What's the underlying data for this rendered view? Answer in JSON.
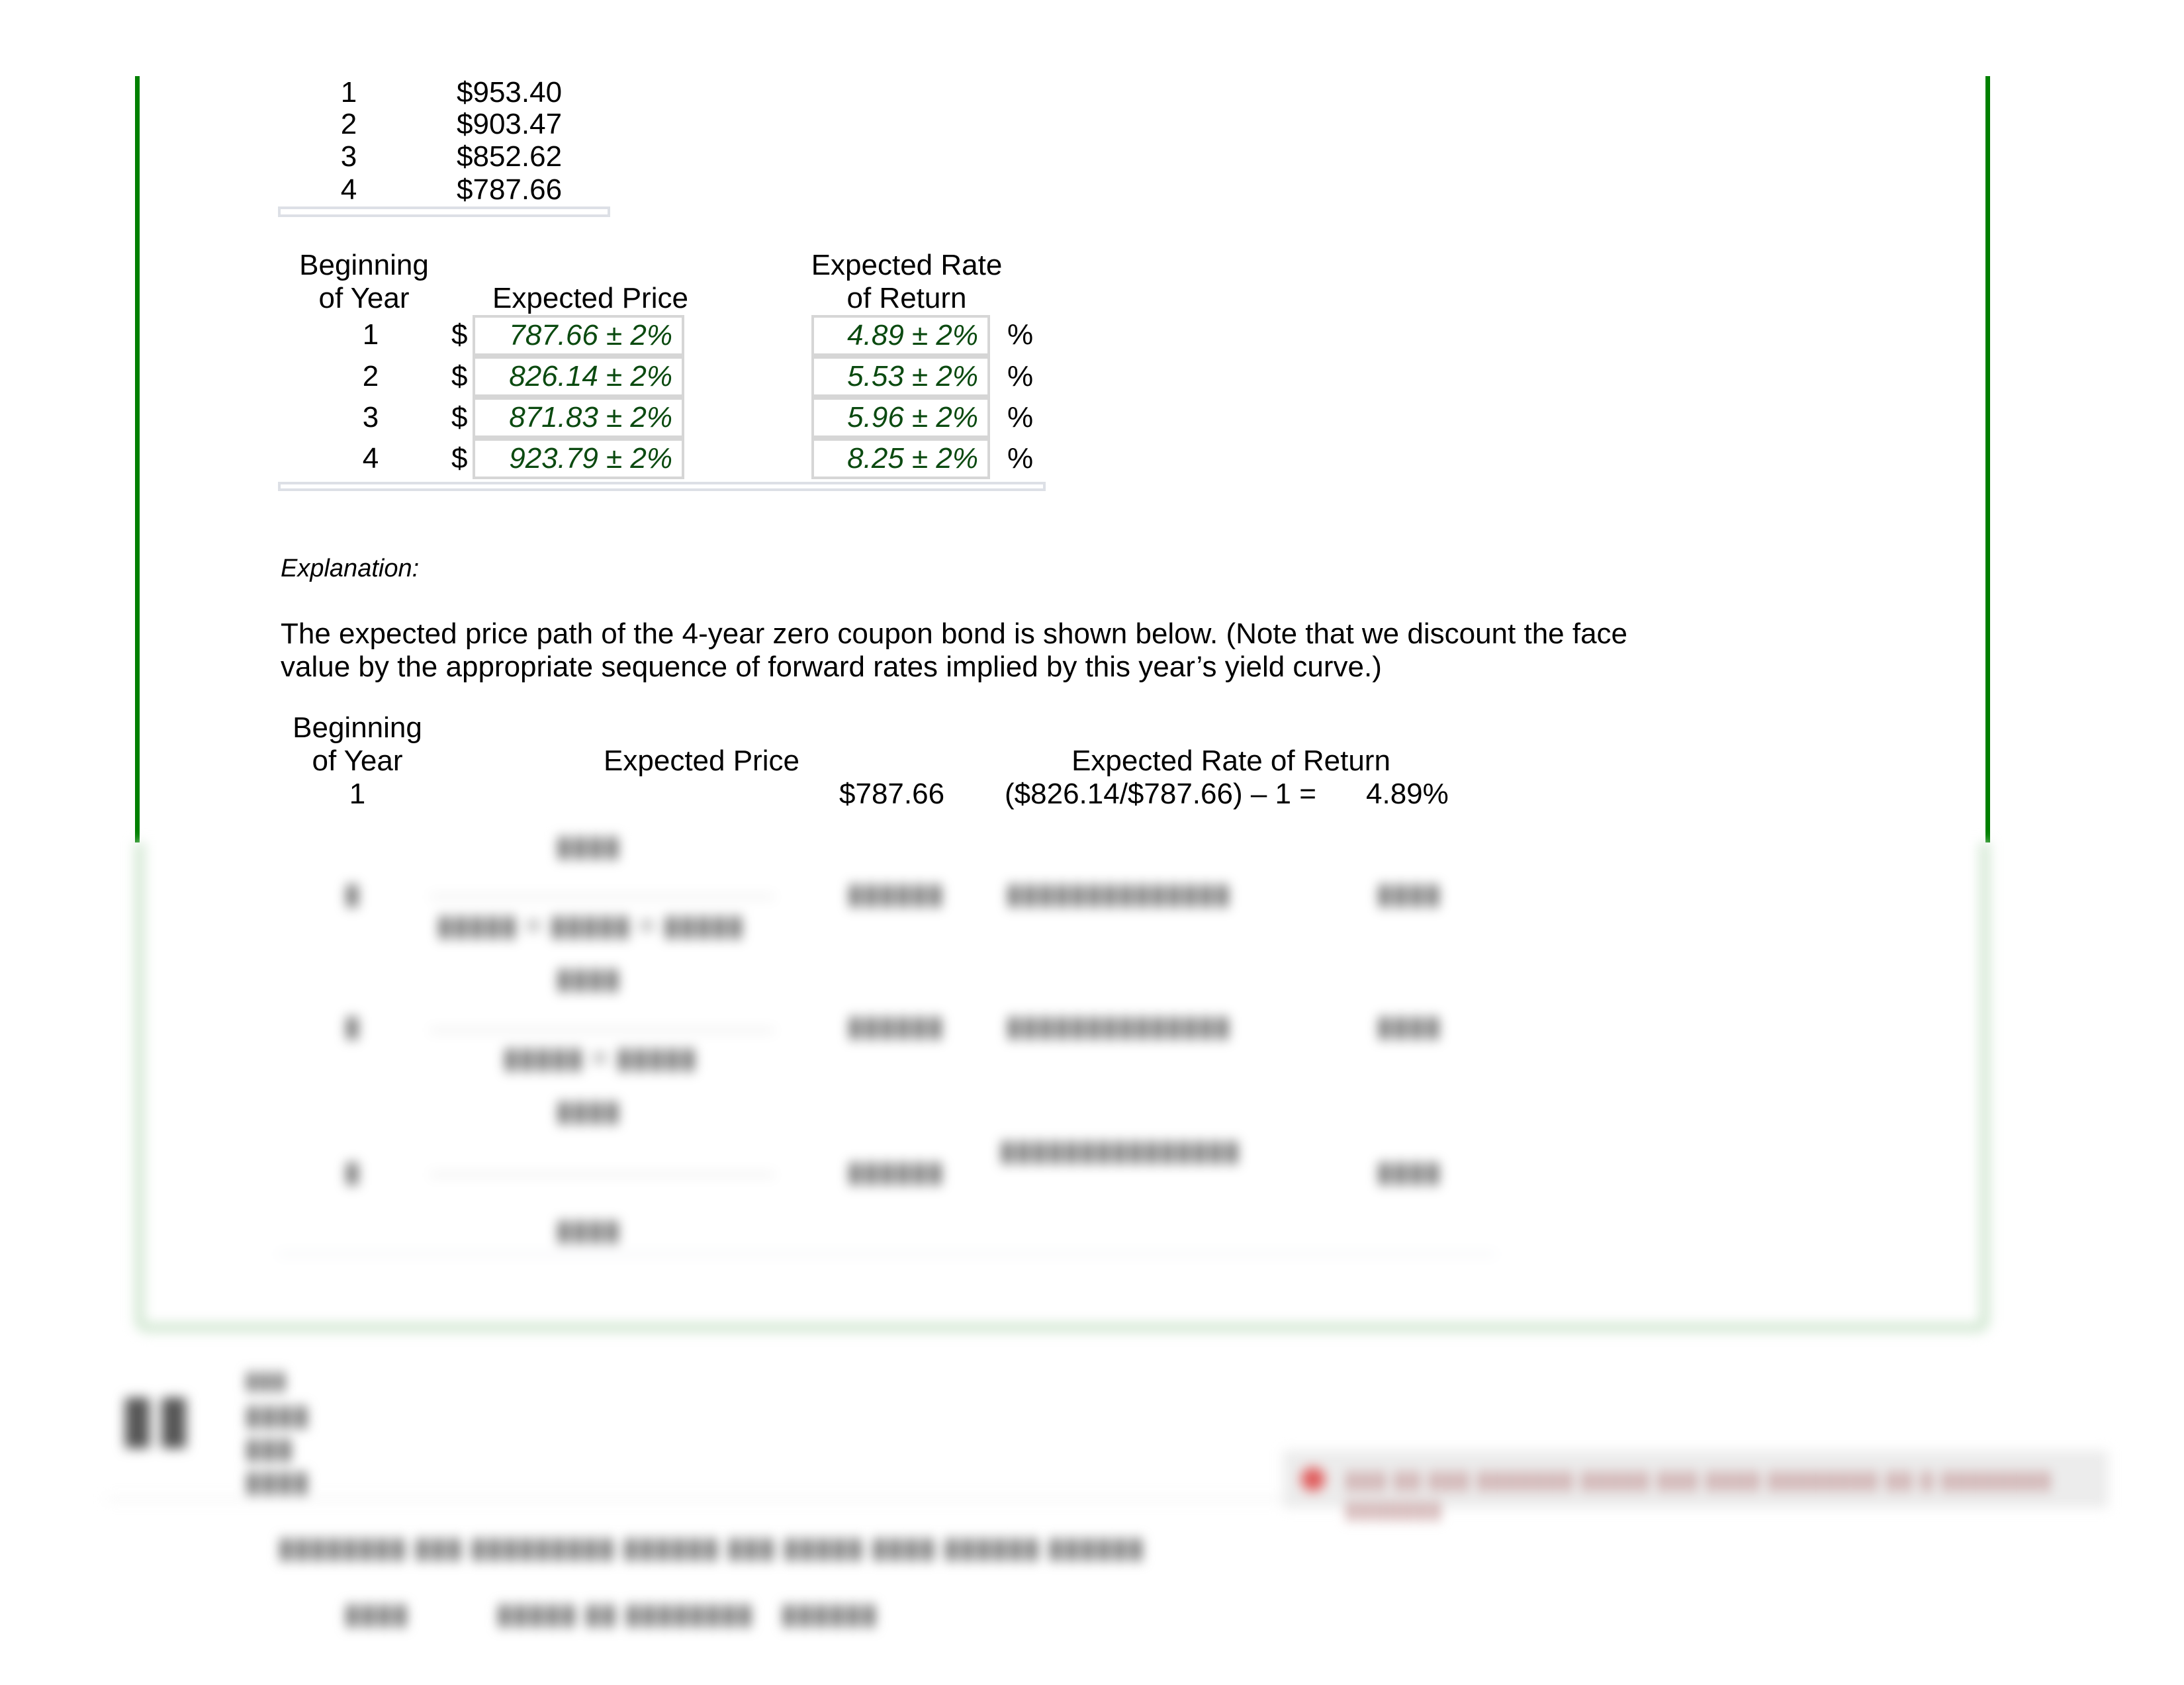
{
  "top_table": {
    "rows": [
      {
        "year": "1",
        "price": "$953.40"
      },
      {
        "year": "2",
        "price": "$903.47"
      },
      {
        "year": "3",
        "price": "$852.62"
      },
      {
        "year": "4",
        "price": "$787.66"
      }
    ]
  },
  "answer_table": {
    "header_year_line1": "Beginning",
    "header_year_line2": "of Year",
    "header_price": "Expected Price",
    "header_return_line1": "Expected Rate",
    "header_return_line2": "of Return",
    "currency_symbol": "$",
    "percent_symbol": "%",
    "rows": [
      {
        "year": "1",
        "price": "787.66 ± 2%",
        "return": "4.89 ± 2%"
      },
      {
        "year": "2",
        "price": "826.14 ± 2%",
        "return": "5.53 ± 2%"
      },
      {
        "year": "3",
        "price": "871.83 ± 2%",
        "return": "5.96 ± 2%"
      },
      {
        "year": "4",
        "price": "923.79 ± 2%",
        "return": "8.25 ± 2%"
      }
    ]
  },
  "explanation": {
    "label": "Explanation:",
    "paragraph_line1": "The expected price path of the 4-year zero coupon bond is shown below. (Note that we discount the face",
    "paragraph_line2": "value by the appropriate sequence of forward rates implied by this year’s yield curve.)",
    "table": {
      "header_year_line1": "Beginning",
      "header_year_line2": "of Year",
      "header_price": "Expected Price",
      "header_return": "Expected Rate of Return",
      "visible_rows": [
        {
          "year": "1",
          "price": "$787.66",
          "formula": "($826.14/$787.66) – 1 =",
          "result": "4.89%"
        }
      ]
    }
  },
  "colors": {
    "correct_border": "#008000",
    "answer_text": "#0b4a10",
    "input_border": "#d6d6d6",
    "alert_icon": "#e05a5a"
  }
}
